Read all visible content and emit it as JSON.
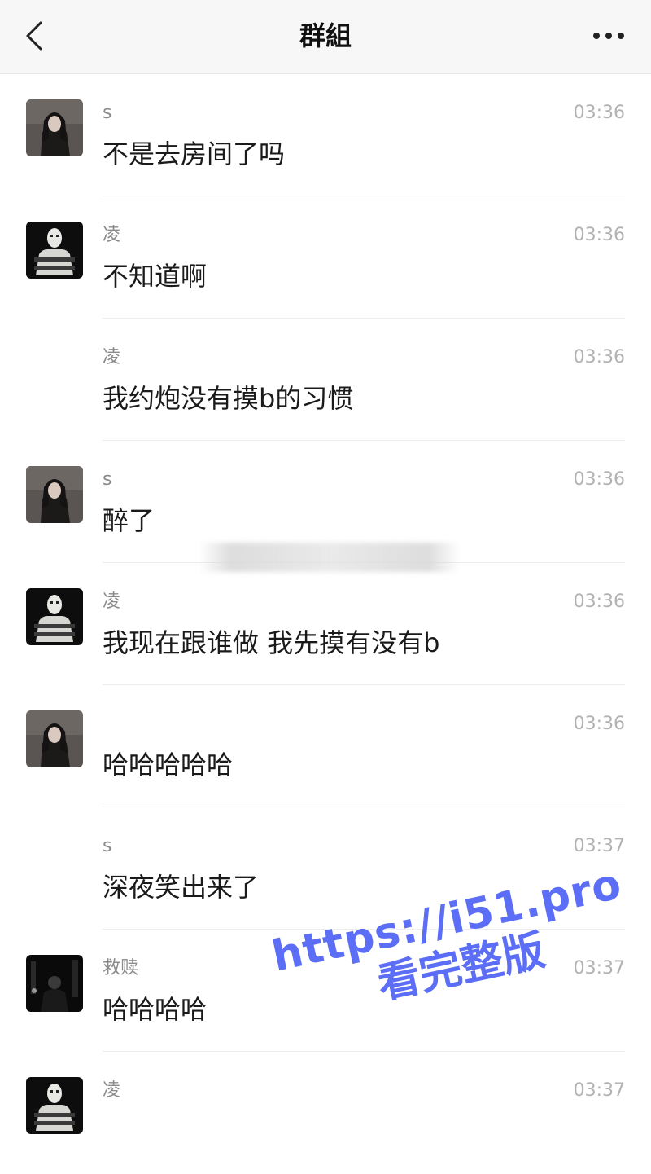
{
  "header": {
    "title": "群組",
    "back_icon": "chevron-left-icon",
    "more_icon": "more-horizontal-icon"
  },
  "messages": [
    {
      "sender": "s",
      "time": "03:36",
      "text": "不是去房间了吗",
      "avatar": "girl"
    },
    {
      "sender": "凌",
      "time": "03:36",
      "text": "不知道啊",
      "avatar": "mask"
    },
    {
      "sender": "凌",
      "time": "03:36",
      "text": "我约炮没有摸b的习惯",
      "avatar": "none"
    },
    {
      "sender": "s",
      "time": "03:36",
      "text": "醉了",
      "avatar": "girl"
    },
    {
      "sender": "凌",
      "time": "03:36",
      "text": "我现在跟谁做 我先摸有没有b",
      "avatar": "mask"
    },
    {
      "sender": "",
      "time": "03:36",
      "text": "哈哈哈哈哈",
      "avatar": "girl"
    },
    {
      "sender": "s",
      "time": "03:37",
      "text": "深夜笑出来了",
      "avatar": "none"
    },
    {
      "sender": "救赎",
      "time": "03:37",
      "text": "哈哈哈哈",
      "avatar": "dark"
    },
    {
      "sender": "凌",
      "time": "03:37",
      "text": "",
      "avatar": "mask"
    }
  ],
  "watermark": {
    "line1": "https://i51.pro",
    "line2": "看完整版"
  },
  "colors": {
    "header_bg": "#f7f7f7",
    "text": "#1a1a1a",
    "name": "#8a8a8a",
    "time": "#b2b2b2",
    "watermark": "#5b6ef5"
  }
}
